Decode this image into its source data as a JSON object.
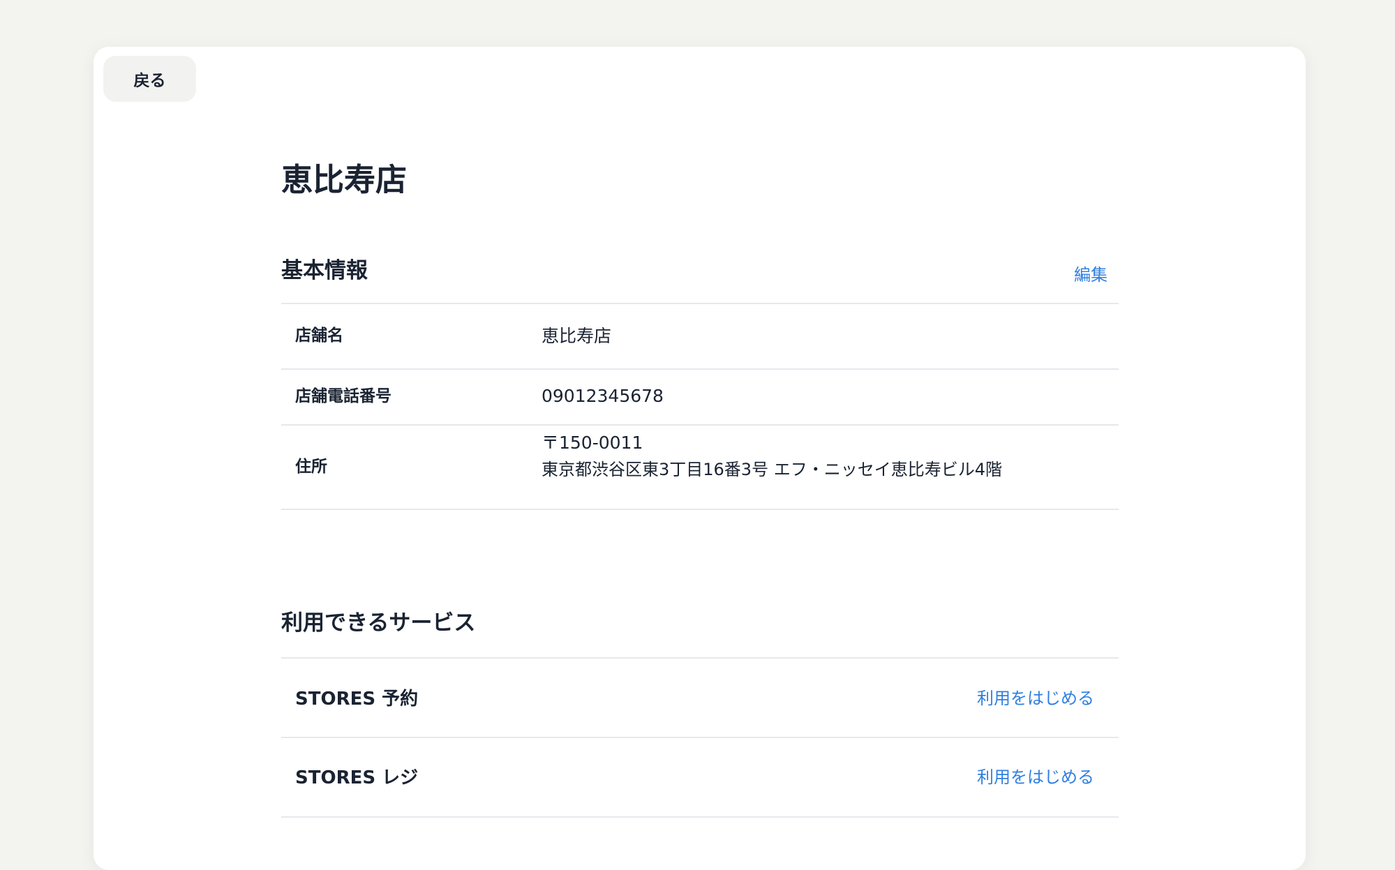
{
  "nav": {
    "back_label": "戻る"
  },
  "page": {
    "title": "恵比寿店"
  },
  "basic_info": {
    "title": "基本情報",
    "edit_label": "編集",
    "rows": [
      {
        "label": "店舗名",
        "value": "恵比寿店"
      },
      {
        "label": "店舗電話番号",
        "value": "09012345678"
      },
      {
        "label": "住所",
        "postal": "〒150-0011",
        "address": "東京都渋谷区東3丁目16番3号 エフ・ニッセイ恵比寿ビル4階"
      }
    ]
  },
  "services": {
    "title": "利用できるサービス",
    "items": [
      {
        "name": "STORES 予約",
        "action_label": "利用をはじめる"
      },
      {
        "name": "STORES レジ",
        "action_label": "利用をはじめる"
      }
    ]
  },
  "colors": {
    "accent": "#2f7fe0",
    "text": "#1a2332",
    "background": "#f3f3f0",
    "card": "#ffffff",
    "divider": "#e6e8ec"
  }
}
